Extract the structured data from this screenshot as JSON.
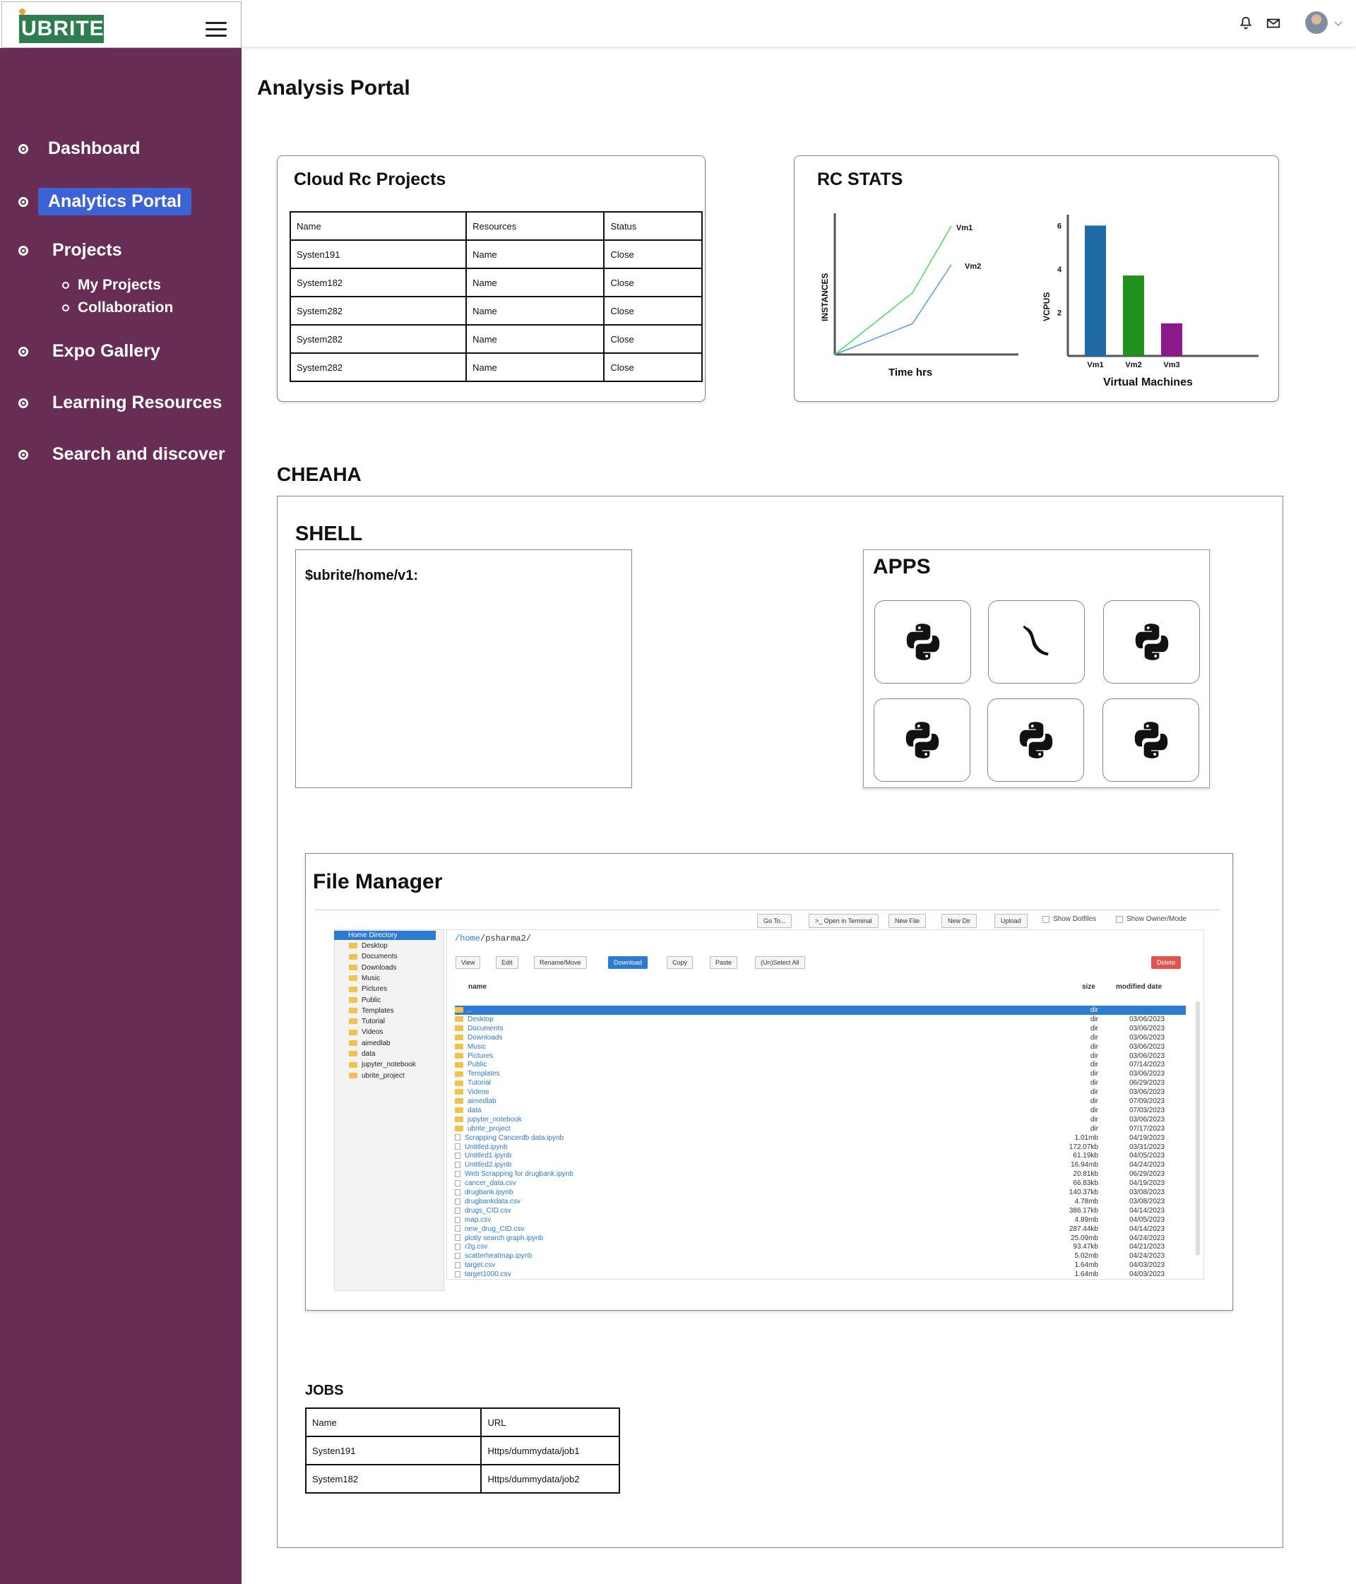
{
  "app": {
    "logo": "UBRITE"
  },
  "sidebar": {
    "items": [
      {
        "label": "Dashboard"
      },
      {
        "label": "Analytics Portal"
      },
      {
        "label": "Projects"
      },
      {
        "label": "Expo Gallery"
      },
      {
        "label": "Learning Resources"
      },
      {
        "label": "Search and discover"
      }
    ],
    "sub_items": [
      {
        "label": "My Projects"
      },
      {
        "label": "Collaboration"
      }
    ]
  },
  "page": {
    "title": "Analysis Portal"
  },
  "cloud_projects": {
    "title": "Cloud Rc Projects",
    "headers": [
      "Name",
      "Resources",
      "Status"
    ],
    "rows": [
      [
        "Systen191",
        "Name",
        "Close"
      ],
      [
        "System182",
        "Name",
        "Close"
      ],
      [
        "System282",
        "Name",
        "Close"
      ],
      [
        "System282",
        "Name",
        "Close"
      ],
      [
        "System282",
        "Name",
        "Close"
      ]
    ]
  },
  "rc_stats": {
    "title": "RC STATS"
  },
  "chart_data": [
    {
      "type": "line",
      "title": "",
      "xlabel": "Time hrs",
      "ylabel": "INSTANCES",
      "series": [
        {
          "name": "Vm1",
          "x": [
            0,
            1,
            2,
            3
          ],
          "values": [
            0,
            1.2,
            2.4,
            5
          ]
        },
        {
          "name": "Vm2",
          "x": [
            0,
            1,
            2,
            3
          ],
          "values": [
            0,
            0.6,
            1.2,
            3.5
          ]
        }
      ],
      "colors": {
        "Vm1": "#4cd964",
        "Vm2": "#5b9be0"
      }
    },
    {
      "type": "bar",
      "title": "",
      "xlabel": "Virtual Machines",
      "ylabel": "VCPUS",
      "categories": [
        "Vm1",
        "Vm2",
        "Vm3"
      ],
      "values": [
        6,
        3.7,
        1.5
      ],
      "yticks": [
        "2",
        "4",
        "6"
      ],
      "ylim": [
        0,
        6.5
      ],
      "colors": [
        "#1f6aa5",
        "#22901e",
        "#8a1a8a"
      ]
    }
  ],
  "cheaha": {
    "title": "CHEAHA"
  },
  "shell": {
    "title": "SHELL",
    "prompt": "$ubrite/home/v1:"
  },
  "apps": {
    "title": "APPS",
    "items": [
      {
        "icon": "python-icon"
      },
      {
        "icon": "flask-icon"
      },
      {
        "icon": "python-icon"
      },
      {
        "icon": "python-icon"
      },
      {
        "icon": "python-icon"
      },
      {
        "icon": "python-icon"
      }
    ]
  },
  "file_manager": {
    "title": "File Manager",
    "toolbar": [
      "Go To...",
      ">_ Open in Terminal",
      "New File",
      "New Dir",
      "Upload"
    ],
    "show_dotfiles": "Show Dotfiles",
    "show_owner": "Show Owner/Mode",
    "tree_root": "Home Directory",
    "tree": [
      "Desktop",
      "Documents",
      "Downloads",
      "Music",
      "Pictures",
      "Public",
      "Templates",
      "Tutorial",
      "Videos",
      "aimedlab",
      "data",
      "jupyter_notebook",
      "ubrite_project"
    ],
    "path_prefix": "/home",
    "path_rest": "/psharma2/",
    "actions": [
      "View",
      "Edit",
      "Rename/Move",
      "Download",
      "Copy",
      "Paste",
      "(Un)Select All"
    ],
    "delete_label": "Delete",
    "col_name": "name",
    "col_size": "size",
    "col_date": "modified date",
    "files": [
      {
        "name": "..",
        "size": "dir",
        "date": "",
        "dir": true
      },
      {
        "name": "Desktop",
        "size": "dir",
        "date": "03/06/2023",
        "dir": true
      },
      {
        "name": "Documents",
        "size": "dir",
        "date": "03/06/2023",
        "dir": true
      },
      {
        "name": "Downloads",
        "size": "dir",
        "date": "03/06/2023",
        "dir": true
      },
      {
        "name": "Music",
        "size": "dir",
        "date": "03/06/2023",
        "dir": true
      },
      {
        "name": "Pictures",
        "size": "dir",
        "date": "03/06/2023",
        "dir": true
      },
      {
        "name": "Public",
        "size": "dir",
        "date": "07/14/2023",
        "dir": true
      },
      {
        "name": "Templates",
        "size": "dir",
        "date": "03/06/2023",
        "dir": true
      },
      {
        "name": "Tutorial",
        "size": "dir",
        "date": "06/29/2023",
        "dir": true
      },
      {
        "name": "Videos",
        "size": "dir",
        "date": "03/06/2023",
        "dir": true
      },
      {
        "name": "aimedlab",
        "size": "dir",
        "date": "07/09/2023",
        "dir": true
      },
      {
        "name": "data",
        "size": "dir",
        "date": "07/03/2023",
        "dir": true
      },
      {
        "name": "jupyter_notebook",
        "size": "dir",
        "date": "03/06/2023",
        "dir": true
      },
      {
        "name": "ubrite_project",
        "size": "dir",
        "date": "07/17/2023",
        "dir": true
      },
      {
        "name": "Scrapping Cancerdb data.ipynb",
        "size": "1.01mb",
        "date": "04/19/2023",
        "dir": false
      },
      {
        "name": "Untitled.ipynb",
        "size": "172.07kb",
        "date": "03/31/2023",
        "dir": false
      },
      {
        "name": "Untitled1.ipynb",
        "size": "61.19kb",
        "date": "04/05/2023",
        "dir": false
      },
      {
        "name": "Untitled2.ipynb",
        "size": "16.94mb",
        "date": "04/24/2023",
        "dir": false
      },
      {
        "name": "Web Scrapping for drugbank.ipynb",
        "size": "20.81kb",
        "date": "06/29/2023",
        "dir": false
      },
      {
        "name": "cancer_data.csv",
        "size": "66.83kb",
        "date": "04/19/2023",
        "dir": false
      },
      {
        "name": "drugbank.ipynb",
        "size": "140.37kb",
        "date": "03/08/2023",
        "dir": false
      },
      {
        "name": "drugbankdata.csv",
        "size": "4.78mb",
        "date": "03/08/2023",
        "dir": false
      },
      {
        "name": "drugs_CID.csv",
        "size": "386.17kb",
        "date": "04/14/2023",
        "dir": false
      },
      {
        "name": "map.csv",
        "size": "4.89mb",
        "date": "04/05/2023",
        "dir": false
      },
      {
        "name": "new_drug_CID.csv",
        "size": "287.44kb",
        "date": "04/14/2023",
        "dir": false
      },
      {
        "name": "plotly search graph.ipynb",
        "size": "25.09mb",
        "date": "04/24/2023",
        "dir": false
      },
      {
        "name": "r2g.csv",
        "size": "93.47kb",
        "date": "04/21/2023",
        "dir": false
      },
      {
        "name": "scatterheatmap.ipynb",
        "size": "5.02mb",
        "date": "04/24/2023",
        "dir": false
      },
      {
        "name": "target.csv",
        "size": "1.64mb",
        "date": "04/03/2023",
        "dir": false
      },
      {
        "name": "target1000.csv",
        "size": "1.64mb",
        "date": "04/03/2023",
        "dir": false
      }
    ]
  },
  "jobs": {
    "title": "JOBS",
    "headers": [
      "Name",
      "URL"
    ],
    "rows": [
      [
        "Systen191",
        "Https/dummydata/job1"
      ],
      [
        "System182",
        "Https/dummydata/job2"
      ]
    ]
  },
  "colors": {
    "sidebar": "#682d55",
    "accent": "#3c63d6",
    "brand": "#2e7d4f"
  }
}
